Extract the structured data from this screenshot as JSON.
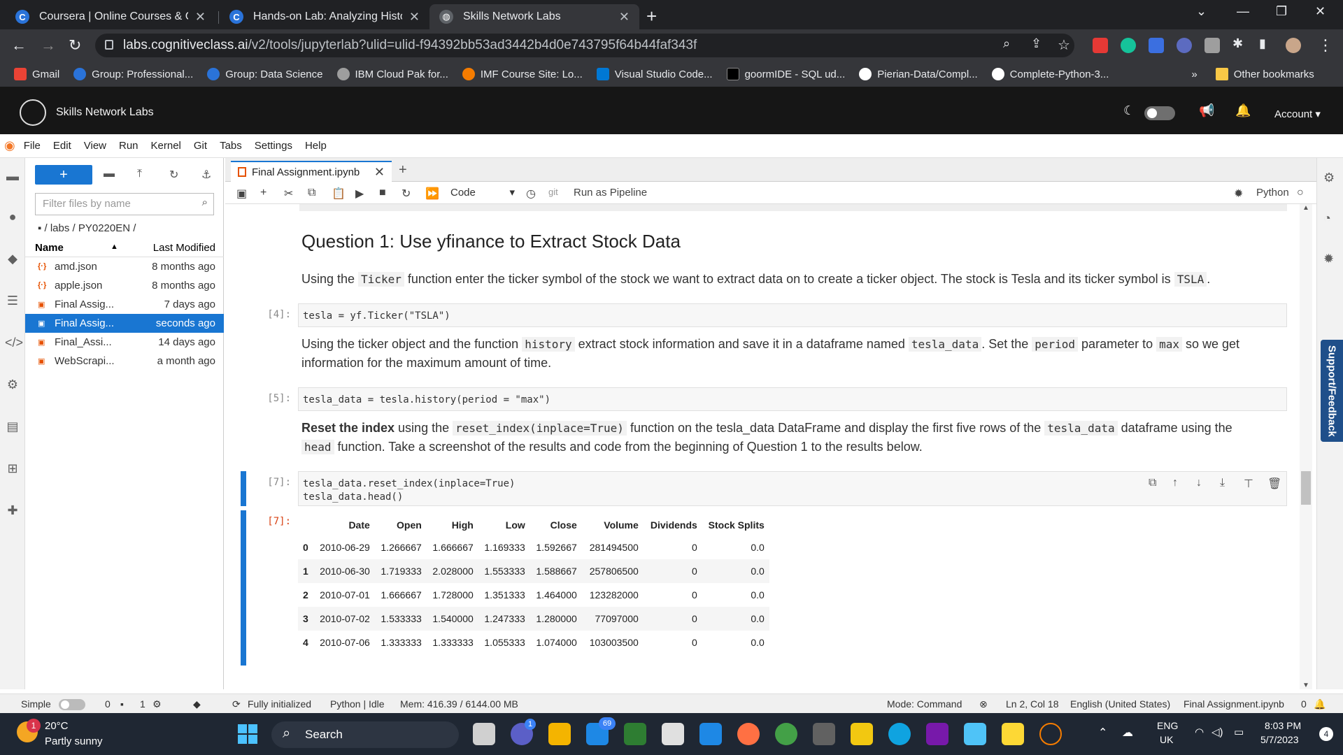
{
  "browser": {
    "tabs": [
      {
        "title": "Coursera | Online Courses & Cred",
        "favicon": "C"
      },
      {
        "title": "Hands-on Lab: Analyzing Historic",
        "favicon": "C"
      },
      {
        "title": "Skills Network Labs",
        "favicon": "globe"
      }
    ],
    "url_host": "labs.cognitiveclass.ai",
    "url_path": "/v2/tools/jupyterlab?ulid=ulid-f94392bb53ad3442b4d0e743795f64b44faf343f",
    "bookmarks": [
      {
        "label": "Gmail",
        "color": "#ea4335"
      },
      {
        "label": "Group: Professional...",
        "color": "#2a73d9"
      },
      {
        "label": "Group: Data Science",
        "color": "#2a73d9"
      },
      {
        "label": "IBM Cloud Pak for...",
        "color": "#9e9e9e"
      },
      {
        "label": "IMF Course Site: Lo...",
        "color": "#f57c00"
      },
      {
        "label": "Visual Studio Code...",
        "color": "#0078d4"
      },
      {
        "label": "goormIDE - SQL ud...",
        "color": "#000000"
      },
      {
        "label": "Pierian-Data/Compl...",
        "color": "#ffffff"
      },
      {
        "label": "Complete-Python-3...",
        "color": "#ffffff"
      }
    ],
    "bookmarks_more": "»",
    "other_bookmarks": "Other bookmarks"
  },
  "header": {
    "title": "Skills Network Labs",
    "account": "Account"
  },
  "menu": [
    "File",
    "Edit",
    "View",
    "Run",
    "Kernel",
    "Git",
    "Tabs",
    "Settings",
    "Help"
  ],
  "filebrowser": {
    "filter_placeholder": "Filter files by name",
    "breadcrumb": "/ labs / PY0220EN /",
    "col_name": "Name",
    "col_modified": "Last Modified",
    "files": [
      {
        "name": "amd.json",
        "modified": "8 months ago",
        "type": "json"
      },
      {
        "name": "apple.json",
        "modified": "8 months ago",
        "type": "json"
      },
      {
        "name": "Final Assig...",
        "modified": "7 days ago",
        "type": "notebook"
      },
      {
        "name": "Final Assig...",
        "modified": "seconds ago",
        "type": "notebook",
        "selected": true
      },
      {
        "name": "Final_Assi...",
        "modified": "14 days ago",
        "type": "notebook"
      },
      {
        "name": "WebScrapi...",
        "modified": "a month ago",
        "type": "notebook"
      }
    ]
  },
  "notebook": {
    "tab_title": "Final Assignment.ipynb",
    "cell_type": "Code",
    "git_label": "git",
    "run_pipeline": "Run as Pipeline",
    "kernel": "Python",
    "heading": "Question 1: Use yfinance to Extract Stock Data",
    "md1": {
      "pre": "Using the ",
      "code1": "Ticker",
      "mid": " function enter the ticker symbol of the stock we want to extract data on to create a ticker object. The stock is Tesla and its ticker symbol is ",
      "code2": "TSLA",
      "post": "."
    },
    "cell4": {
      "prompt": "[4]:",
      "code": "tesla = yf.Ticker(\"TSLA\")"
    },
    "md2": {
      "p1": "Using the ticker object and the function ",
      "c1": "history",
      "p2": " extract stock information and save it in a dataframe named ",
      "c2": "tesla_data",
      "p3": ". Set the ",
      "c3": "period",
      "p4": " parameter to ",
      "c4": "max",
      "p5": " so we get information for the maximum amount of time."
    },
    "cell5": {
      "prompt": "[5]:",
      "code": "tesla_data = tesla.history(period = \"max\")"
    },
    "md3": {
      "bold": "Reset the index",
      "p1": " using the ",
      "c1": "reset_index(inplace=True)",
      "p2": " function on the tesla_data DataFrame and display the first five rows of the ",
      "c2": "tesla_data",
      "p3": " dataframe using the ",
      "c3": "head",
      "p4": " function. Take a screenshot of the results and code from the beginning of Question 1 to the results below."
    },
    "cell7": {
      "prompt": "[7]:",
      "line1": "tesla_data.reset_index(inplace=True)",
      "line2": "tesla_data.head()",
      "out_prompt": "[7]:"
    },
    "table": {
      "columns": [
        "",
        "Date",
        "Open",
        "High",
        "Low",
        "Close",
        "Volume",
        "Dividends",
        "Stock Splits"
      ],
      "rows": [
        [
          "0",
          "2010-06-29",
          "1.266667",
          "1.666667",
          "1.169333",
          "1.592667",
          "281494500",
          "0",
          "0.0"
        ],
        [
          "1",
          "2010-06-30",
          "1.719333",
          "2.028000",
          "1.553333",
          "1.588667",
          "257806500",
          "0",
          "0.0"
        ],
        [
          "2",
          "2010-07-01",
          "1.666667",
          "1.728000",
          "1.351333",
          "1.464000",
          "123282000",
          "0",
          "0.0"
        ],
        [
          "3",
          "2010-07-02",
          "1.533333",
          "1.540000",
          "1.247333",
          "1.280000",
          "77097000",
          "0",
          "0.0"
        ],
        [
          "4",
          "2010-07-06",
          "1.333333",
          "1.333333",
          "1.055333",
          "1.074000",
          "103003500",
          "0",
          "0.0"
        ]
      ]
    }
  },
  "feedback": "Support/Feedback",
  "statusbar": {
    "simple": "Simple",
    "terminals": "0",
    "kernels": "1",
    "initialized": "Fully initialized",
    "kernel_status": "Python | Idle",
    "mem": "Mem: 416.39 / 6144.00 MB",
    "mode": "Mode: Command",
    "position": "Ln 2, Col 18",
    "language": "English (United States)",
    "file": "Final Assignment.ipynb",
    "notifications": "0"
  },
  "taskbar": {
    "weather_temp": "20°C",
    "weather_desc": "Partly sunny",
    "weather_badge": "1",
    "search": "Search",
    "lang1": "ENG",
    "lang2": "UK",
    "time": "8:03 PM",
    "date": "5/7/2023",
    "notif_count": "4",
    "mail_badge": "69",
    "teams_badge": "1"
  }
}
